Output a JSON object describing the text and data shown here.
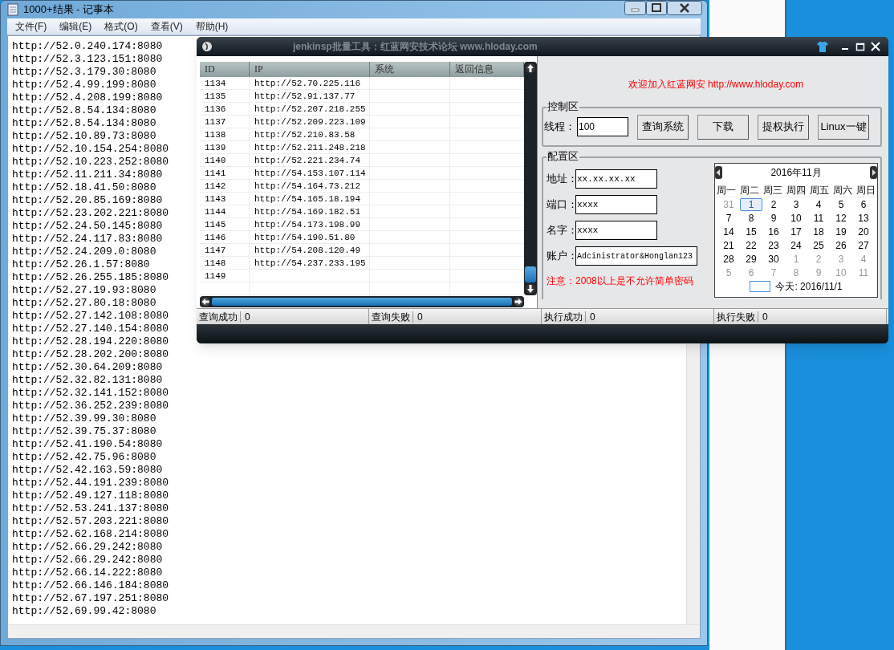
{
  "notepad": {
    "title": "1000+结果 - 记事本",
    "menu": [
      "文件(F)",
      "编辑(E)",
      "格式(O)",
      "查看(V)",
      "帮助(H)"
    ],
    "lines": [
      "http://52.0.240.174:8080",
      "http://52.3.123.151:8080",
      "http://52.3.179.30:8080",
      "http://52.4.99.199:8080",
      "http://52.4.208.199:8080",
      "http://52.8.54.134:8080",
      "http://52.8.54.134:8080",
      "http://52.10.89.73:8080",
      "http://52.10.154.254:8080",
      "http://52.10.223.252:8080",
      "http://52.11.211.34:8080",
      "http://52.18.41.50:8080",
      "http://52.20.85.169:8080",
      "http://52.23.202.221:8080",
      "http://52.24.50.145:8080",
      "http://52.24.117.83:8080",
      "http://52.24.209.0:8080",
      "http://52.26.1.57:8080",
      "http://52.26.255.185:8080",
      "http://52.27.19.93:8080",
      "http://52.27.80.18:8080",
      "http://52.27.142.108:8080",
      "http://52.27.140.154:8080",
      "http://52.28.194.220:8080",
      "http://52.28.202.200:8080",
      "http://52.30.64.209:8080",
      "http://52.32.82.131:8080",
      "http://52.32.141.152:8080",
      "http://52.36.252.239:8080",
      "http://52.39.99.30:8080",
      "http://52.39.75.37:8080",
      "http://52.41.190.54:8080",
      "http://52.42.75.96:8080",
      "http://52.42.163.59:8080",
      "http://52.44.191.239:8080",
      "http://52.49.127.118:8080",
      "http://52.53.241.137:8080",
      "http://52.57.203.221:8080",
      "http://52.62.168.214:8080",
      "http://52.66.29.242:8080",
      "http://52.66.29.242:8080",
      "http://52.66.14.222:8080",
      "http://52.66.146.184:8080",
      "http://52.67.197.251:8080",
      "http://52.69.99.42:8080"
    ]
  },
  "tool": {
    "title": "jenkinsp批量工具：红蓝网安技术论坛 www.hloday.com",
    "table": {
      "columns": [
        "ID",
        "IP",
        "系统",
        "返回信息"
      ],
      "rows": [
        {
          "id": "1134",
          "ip": "http://52.70.225.116"
        },
        {
          "id": "1135",
          "ip": "http://52.91.137.77"
        },
        {
          "id": "1136",
          "ip": "http://52.207.218.255"
        },
        {
          "id": "1137",
          "ip": "http://52.209.223.109"
        },
        {
          "id": "1138",
          "ip": "http://52.210.83.58"
        },
        {
          "id": "1139",
          "ip": "http://52.211.248.218"
        },
        {
          "id": "1140",
          "ip": "http://52.221.234.74"
        },
        {
          "id": "1141",
          "ip": "http://54.153.107.114"
        },
        {
          "id": "1142",
          "ip": "http://54.164.73.212"
        },
        {
          "id": "1143",
          "ip": "http://54.165.18.194"
        },
        {
          "id": "1144",
          "ip": "http://54.169.182.51"
        },
        {
          "id": "1145",
          "ip": "http://54.173.198.99"
        },
        {
          "id": "1146",
          "ip": "http://54.190.51.80"
        },
        {
          "id": "1147",
          "ip": "http://54.208.120.49"
        },
        {
          "id": "1148",
          "ip": "http://54.237.233.195"
        },
        {
          "id": "1149"
        }
      ]
    },
    "welcome": "欢迎加入红蓝网安 http://www.hloday.com",
    "control": {
      "legend": "控制区",
      "threads_label": "线程：",
      "threads_value": "100",
      "buttons": [
        "查询系统",
        "下载",
        "提权执行",
        "Linux一键"
      ]
    },
    "config": {
      "legend": "配置区",
      "fields": [
        {
          "label": "地址：",
          "value": "xx.xx.xx.xx"
        },
        {
          "label": "端口：",
          "value": "xxxx"
        },
        {
          "label": "名字：",
          "value": "xxxx"
        },
        {
          "label": "账户：",
          "value": "Adcinistrator&Honglan123"
        }
      ],
      "notice": "注意：2008以上是不允许简单密码",
      "calendar": {
        "month": "2016年11月",
        "weekdays": [
          "周一",
          "周二",
          "周三",
          "周四",
          "周五",
          "周六",
          "周日"
        ],
        "days": [
          {
            "text": "31",
            "muted": true,
            "selected": false
          },
          {
            "text": "1",
            "muted": false,
            "selected": true
          },
          {
            "text": "2",
            "muted": false,
            "selected": false
          },
          {
            "text": "3",
            "muted": false,
            "selected": false
          },
          {
            "text": "4",
            "muted": false,
            "selected": false
          },
          {
            "text": "5",
            "muted": false,
            "selected": false
          },
          {
            "text": "6",
            "muted": false,
            "selected": false
          },
          {
            "text": "7",
            "muted": false,
            "selected": false
          },
          {
            "text": "8",
            "muted": false,
            "selected": false
          },
          {
            "text": "9",
            "muted": false,
            "selected": false
          },
          {
            "text": "10",
            "muted": false,
            "selected": false
          },
          {
            "text": "11",
            "muted": false,
            "selected": false
          },
          {
            "text": "12",
            "muted": false,
            "selected": false
          },
          {
            "text": "13",
            "muted": false,
            "selected": false
          },
          {
            "text": "14",
            "muted": false,
            "selected": false
          },
          {
            "text": "15",
            "muted": false,
            "selected": false
          },
          {
            "text": "16",
            "muted": false,
            "selected": false
          },
          {
            "text": "17",
            "muted": false,
            "selected": false
          },
          {
            "text": "18",
            "muted": false,
            "selected": false
          },
          {
            "text": "19",
            "muted": false,
            "selected": false
          },
          {
            "text": "20",
            "muted": false,
            "selected": false
          },
          {
            "text": "21",
            "muted": false,
            "selected": false
          },
          {
            "text": "22",
            "muted": false,
            "selected": false
          },
          {
            "text": "23",
            "muted": false,
            "selected": false
          },
          {
            "text": "24",
            "muted": false,
            "selected": false
          },
          {
            "text": "25",
            "muted": false,
            "selected": false
          },
          {
            "text": "26",
            "muted": false,
            "selected": false
          },
          {
            "text": "27",
            "muted": false,
            "selected": false
          },
          {
            "text": "28",
            "muted": false,
            "selected": false
          },
          {
            "text": "29",
            "muted": false,
            "selected": false
          },
          {
            "text": "30",
            "muted": false,
            "selected": false
          },
          {
            "text": "1",
            "muted": true,
            "selected": false
          },
          {
            "text": "2",
            "muted": true,
            "selected": false
          },
          {
            "text": "3",
            "muted": true,
            "selected": false
          },
          {
            "text": "4",
            "muted": true,
            "selected": false
          },
          {
            "text": "5",
            "muted": true,
            "selected": false
          },
          {
            "text": "6",
            "muted": true,
            "selected": false
          },
          {
            "text": "7",
            "muted": true,
            "selected": false
          },
          {
            "text": "8",
            "muted": true,
            "selected": false
          },
          {
            "text": "9",
            "muted": true,
            "selected": false
          },
          {
            "text": "10",
            "muted": true,
            "selected": false
          },
          {
            "text": "11",
            "muted": true,
            "selected": false
          }
        ],
        "today": "今天: 2016/11/1"
      }
    },
    "status": [
      {
        "label": "查询成功",
        "value": "0"
      },
      {
        "label": "查询失败",
        "value": "0"
      },
      {
        "label": "执行成功",
        "value": "0"
      },
      {
        "label": "执行失败",
        "value": "0"
      }
    ]
  }
}
